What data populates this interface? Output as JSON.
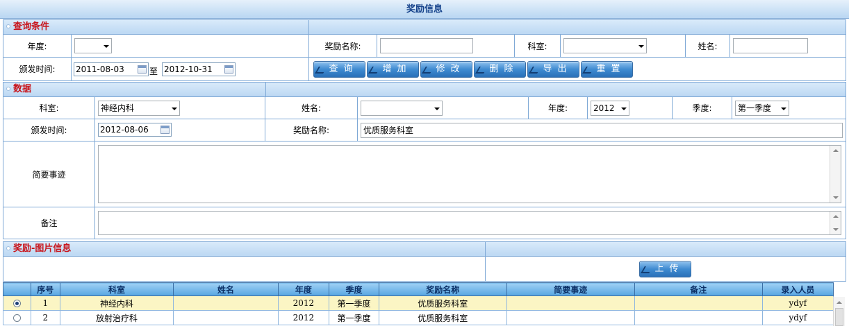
{
  "title": "奖励信息",
  "query": {
    "section_title": "查询条件",
    "year_label": "年度:",
    "year_value": "",
    "award_name_label": "奖励名称:",
    "award_name_value": "",
    "dept_label": "科室:",
    "dept_value": "",
    "person_label": "姓名:",
    "person_value": "",
    "issue_time_label": "颁发时间:",
    "date_from": "2011-08-03",
    "to_label": "至",
    "date_to": "2012-10-31",
    "buttons": [
      "查询",
      "增加",
      "修改",
      "删除",
      "导出",
      "重置"
    ]
  },
  "data_section": {
    "section_title": "数据",
    "dept_label": "科室:",
    "dept_value": "神经内科",
    "person_label": "姓名:",
    "person_value": "",
    "year_label": "年度:",
    "year_value": "2012",
    "quarter_label": "季度:",
    "quarter_value": "第一季度",
    "issue_time_label": "颁发时间:",
    "issue_time_value": "2012-08-06",
    "award_name_label": "奖励名称:",
    "award_name_value": "优质服务科室",
    "summary_label": "简要事迹",
    "summary_value": "",
    "remark_label": "备注",
    "remark_value": ""
  },
  "image_section": {
    "section_title": "奖励-图片信息",
    "upload_label": "上传"
  },
  "grid": {
    "columns": [
      "序号",
      "科室",
      "姓名",
      "年度",
      "季度",
      "奖励名称",
      "简要事迹",
      "备注",
      "录入人员"
    ],
    "rows": [
      {
        "selected": true,
        "cells": [
          "1",
          "神经内科",
          "",
          "2012",
          "第一季度",
          "优质服务科室",
          "",
          "",
          "ydyf"
        ]
      },
      {
        "selected": false,
        "cells": [
          "2",
          "放射治疗科",
          "",
          "2012",
          "第一季度",
          "优质服务科室",
          "",
          "",
          "ydyf"
        ]
      }
    ]
  }
}
